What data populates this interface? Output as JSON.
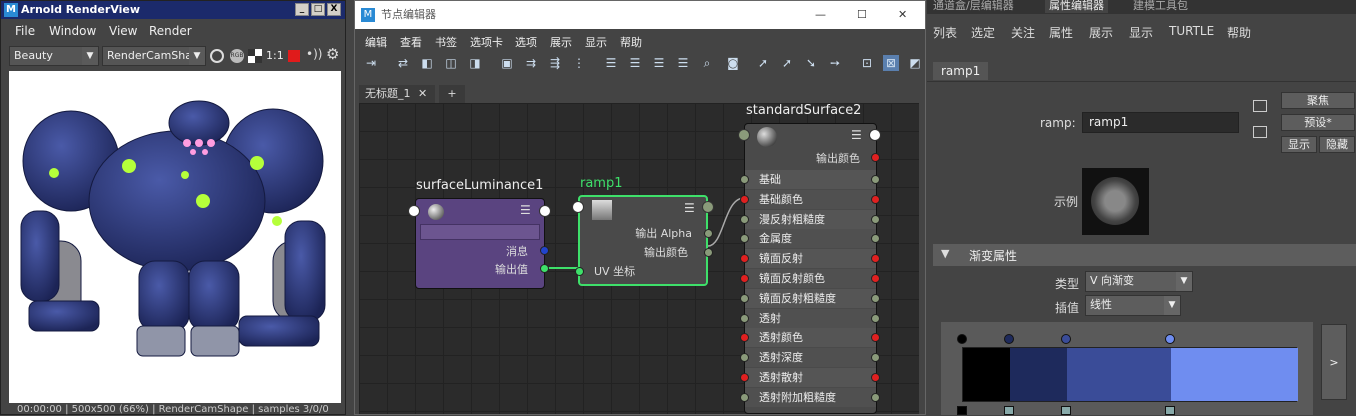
{
  "arnold": {
    "title": "Arnold RenderView",
    "win_min": "_",
    "win_max": "□",
    "win_close": "X",
    "menu": [
      "File",
      "Window",
      "View",
      "Render"
    ],
    "aov": "Beauty",
    "camera": "RenderCamShap",
    "ratio_label": "1:1",
    "status": "00:00:00 | 500x500 (66%) | RenderCamShape | samples 3/0/0"
  },
  "node_editor": {
    "title": "节点编辑器",
    "win_min": "—",
    "win_max": "☐",
    "win_close": "✕",
    "menu": [
      "编辑",
      "查看",
      "书签",
      "选项卡",
      "选项",
      "展示",
      "显示",
      "帮助"
    ],
    "tab_name": "无标题_1",
    "tab_close": "✕",
    "tab_add": "+",
    "nodes": {
      "lum": {
        "name": "surfaceLuminance1",
        "rows": [
          "消息",
          "输出值"
        ]
      },
      "ramp": {
        "name": "ramp1",
        "rows": [
          "输出 Alpha",
          "输出颜色",
          "UV 坐标"
        ]
      },
      "std": {
        "name": "standardSurface2",
        "out": "输出颜色",
        "rows": [
          "基础",
          "基础颜色",
          "漫反射粗糙度",
          "金属度",
          "镜面反射",
          "镜面反射颜色",
          "镜面反射粗糙度",
          "透射",
          "透射颜色",
          "透射深度",
          "透射散射",
          "透射附加粗糙度"
        ]
      }
    }
  },
  "right_panel": {
    "tabs": [
      "通道盒/层编辑器",
      "属性编辑器",
      "建模工具包"
    ],
    "menu": [
      "列表",
      "选定",
      "关注",
      "属性",
      "展示",
      "显示",
      "TURTLE",
      "帮助"
    ],
    "node_tab": "ramp1",
    "field_label": "ramp:",
    "field_value": "ramp1",
    "buttons": {
      "focus": "聚焦",
      "preset": "预设*",
      "show": "显示",
      "hide": "隐藏"
    },
    "sample_label": "示例",
    "section_title": "渐变属性",
    "type_label": "类型",
    "type_value": "V 向渐变",
    "interp_label": "插值",
    "interp_value": "线性",
    "expand_btn": ">",
    "ramp_colors": [
      "#000000",
      "#1e2a5c",
      "#3a4c98",
      "#6f8df0"
    ],
    "ramp_positions": [
      0,
      0.14,
      0.31,
      0.62
    ]
  }
}
